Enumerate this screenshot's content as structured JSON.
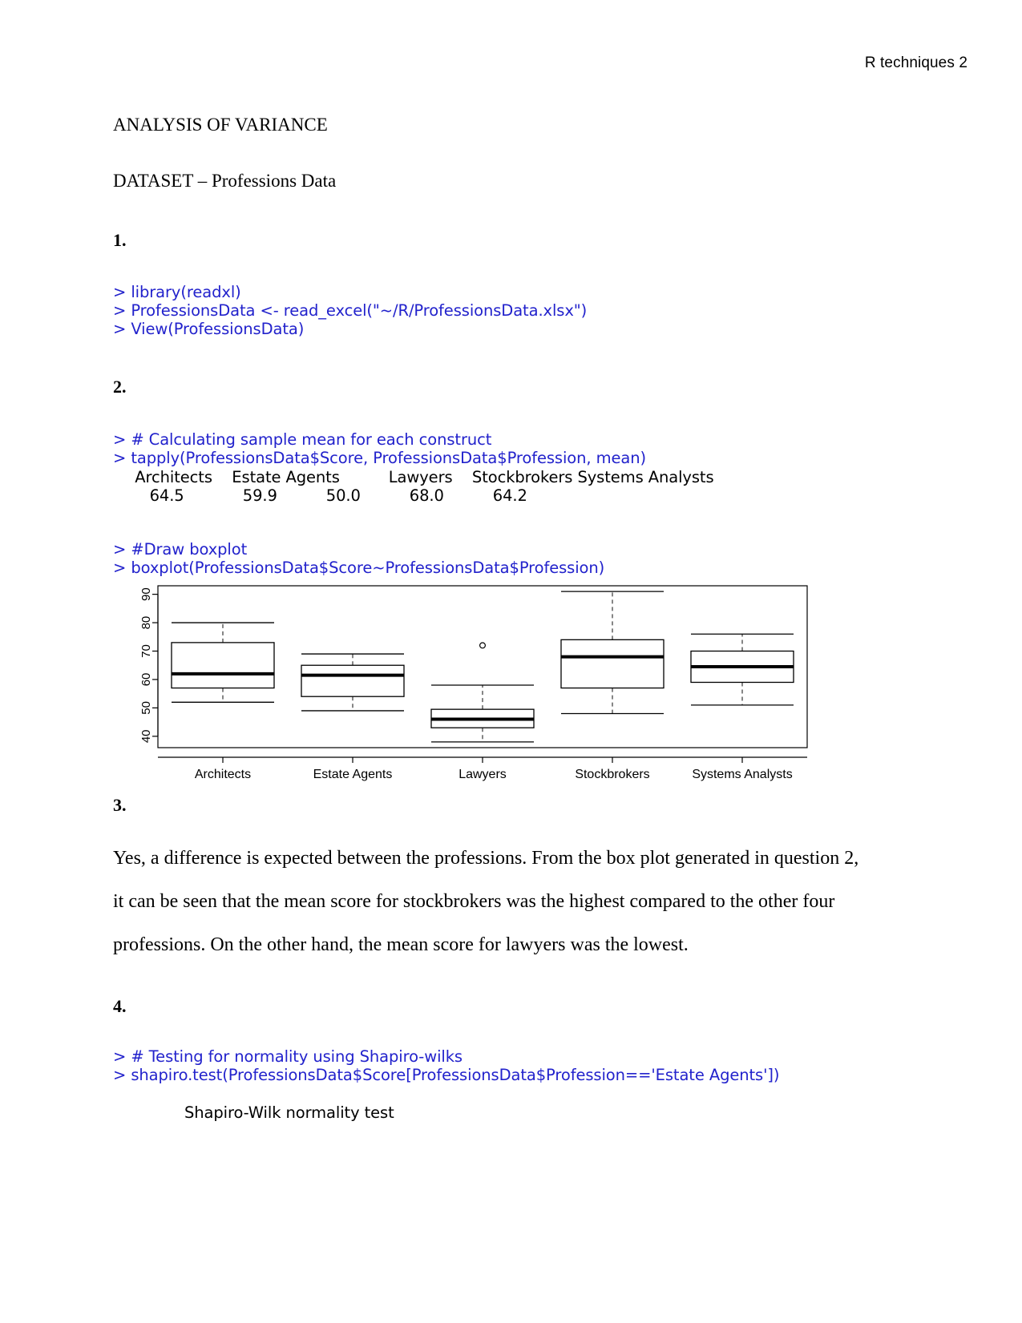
{
  "header": {
    "running_head": "R techniques 2"
  },
  "title": "ANALYSIS OF VARIANCE",
  "dataset_line": "DATASET – Professions Data",
  "sections": {
    "q1": {
      "number": "1.",
      "code": [
        "> library(readxl)",
        "> ProfessionsData <- read_excel(\"~/R/ProfessionsData.xlsx\")",
        "> View(ProfessionsData)"
      ]
    },
    "q2": {
      "number": "2.",
      "code": [
        "> # Calculating sample mean for each construct",
        "> tapply(ProfessionsData$Score, ProfessionsData$Profession, mean)"
      ],
      "output_header": "   Architects    Estate Agents          Lawyers    Stockbrokers Systems Analysts",
      "output_values": "      64.5            59.9          50.0          68.0          64.2",
      "means": {
        "Architects": 64.5,
        "Estate Agents": 59.9,
        "Lawyers": 50.0,
        "Stockbrokers": 68.0,
        "Systems Analysts": 64.2
      },
      "plot_code": [
        "> #Draw boxplot",
        "> boxplot(ProfessionsData$Score~ProfessionsData$Profession)"
      ]
    },
    "q3": {
      "number": "3.",
      "paragraph_lines": [
        "Yes, a difference is expected between the professions. From the box plot generated in question 2,",
        "it can be seen that the mean score for stockbrokers was the highest compared to the other four",
        "professions. On the other hand, the mean score for lawyers was the lowest."
      ]
    },
    "q4": {
      "number": "4.",
      "code": [
        "> # Testing for normality using Shapiro-wilks",
        "> shapiro.test(ProfessionsData$Score[ProfessionsData$Profession=='Estate Agents'])"
      ],
      "result_title": "Shapiro-Wilk normality test"
    }
  },
  "chart_data": {
    "type": "boxplot",
    "title": "",
    "xlabel": "",
    "ylabel": "",
    "ylim": [
      36,
      93
    ],
    "yticks": [
      40,
      50,
      60,
      70,
      80,
      90
    ],
    "ytick_labels": [
      "40",
      "50",
      "60",
      "70",
      "80",
      "90"
    ],
    "grid": false,
    "legend": "none",
    "categories": [
      "Architects",
      "Estate Agents",
      "Lawyers",
      "Stockbrokers",
      "Systems Analysts"
    ],
    "boxes": [
      {
        "name": "Architects",
        "whisker_low": 52,
        "q1": 57,
        "median": 62,
        "q3": 73,
        "whisker_high": 80,
        "outliers": []
      },
      {
        "name": "Estate Agents",
        "whisker_low": 49,
        "q1": 54,
        "median": 61.5,
        "q3": 65,
        "whisker_high": 69,
        "outliers": []
      },
      {
        "name": "Lawyers",
        "whisker_low": 38,
        "q1": 43,
        "median": 46,
        "q3": 49.5,
        "whisker_high": 58,
        "outliers": [
          72
        ]
      },
      {
        "name": "Stockbrokers",
        "whisker_low": 48,
        "q1": 57,
        "median": 68,
        "q3": 74,
        "whisker_high": 91,
        "outliers": []
      },
      {
        "name": "Systems Analysts",
        "whisker_low": 51,
        "q1": 59,
        "median": 64.5,
        "q3": 70,
        "whisker_high": 76,
        "outliers": []
      }
    ]
  }
}
